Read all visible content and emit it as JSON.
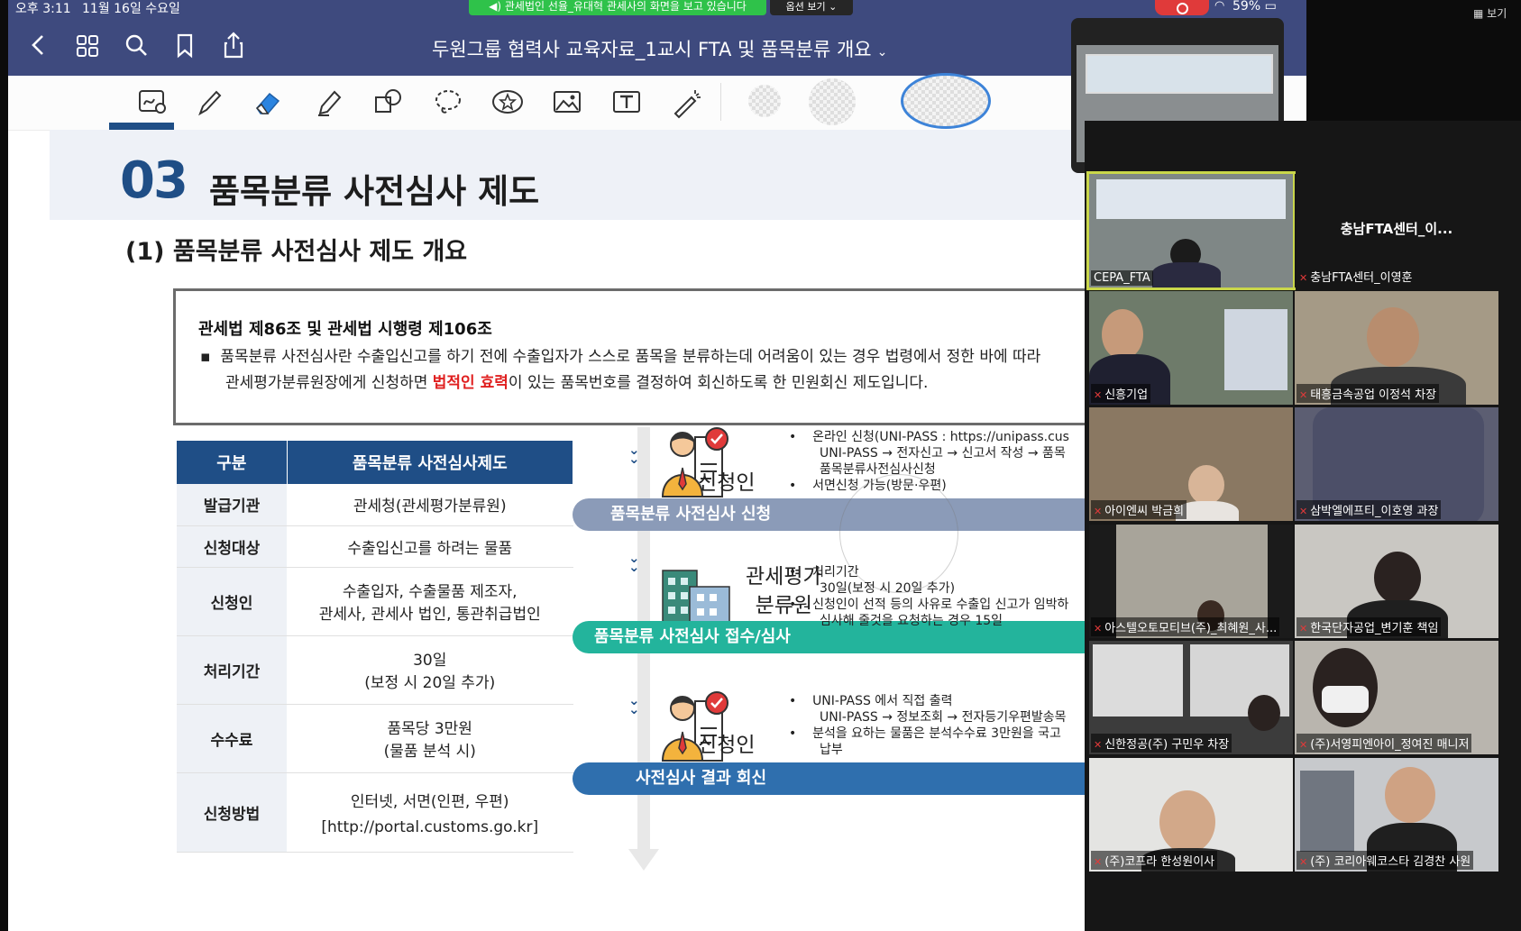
{
  "status_bar": {
    "time": "오후 3:11",
    "date": "11월 16일 수요일",
    "screen_share": "관세법인 선율_유대혁 관세사의 화면을 보고 있습니다",
    "options": "옵션 보기",
    "battery": "59%"
  },
  "view_toggle": "보기",
  "nav": {
    "title": "두원그룹 협력사 교육자료_1교시 FTA 및 품목분류 개요"
  },
  "slide": {
    "number": "03",
    "title": "품목분류 사전심사 제도",
    "subtitle": "(1) 품목분류 사전심사 제도 개요",
    "law_heading": "관세법 제86조 및 관세법 시행령 제106조",
    "law_line1": "품목분류 사전심사란 수출입신고를 하기 전에 수출입자가 스스로 품목을 분류하는데 어려움이 있는 경우 법령에서 정한 바에 따라",
    "law_line2_pre": "관세평가분류원장에게 신청하면 ",
    "law_line2_red": "법적인 효력",
    "law_line2_post": "이 있는 품목번호를 결정하여 회신하도록 한 민원회신 제도입니다."
  },
  "table": {
    "headers": [
      "구분",
      "품목분류 사전심사제도"
    ],
    "rows": [
      {
        "cat": "발급기관",
        "val1": "관세청(관세평가분류원)",
        "val2": ""
      },
      {
        "cat": "신청대상",
        "val1": "수출입신고를 하려는 물품",
        "val2": ""
      },
      {
        "cat": "신청인",
        "val1": "수출입자, 수출물품 제조자,",
        "val2": "관세사, 관세사 법인, 통관취급법인"
      },
      {
        "cat": "처리기간",
        "val1": "30일",
        "val2": "(보정 시 20일 추가)"
      },
      {
        "cat": "수수료",
        "val1": "품목당 3만원",
        "val2": "(물품 분석 시)"
      },
      {
        "cat": "신청방법",
        "val1": "인터넷, 서면(인편, 우편)",
        "val2": "[http://portal.customs.go.kr]"
      }
    ]
  },
  "flow": {
    "step1": {
      "actor": "신청인",
      "bar": "품목분류 사전심사 신청",
      "notes": [
        "온라인 신청(UNI-PASS : https://unipass.cus",
        "UNI-PASS → 전자신고 → 신고서 작성 → 품목",
        "품목분류사전심사신청",
        "서면신청 가능(방문·우편)"
      ]
    },
    "step2": {
      "actor_line1": "관세평가",
      "actor_line2": "분류원",
      "bar": "품목분류 사전심사 접수/심사",
      "notes": [
        "처리기간",
        "30일(보정 시 20일 추가)",
        "신청인이 선적 등의 사유로 수출입 신고가 임박하",
        "심사해 줄것을 요청하는 경우 15일"
      ]
    },
    "step3": {
      "actor": "신청인",
      "bar": "사전심사 결과 회신",
      "notes": [
        "UNI-PASS 에서 직접 출력",
        "UNI-PASS → 정보조회 → 전자등기우편발송목",
        "분석을 요하는 물품은 분석수수료 3만원을 국고",
        "납부"
      ]
    }
  },
  "participants": [
    {
      "name": "CEPA_FTA"
    },
    {
      "name": "충남FTA센터_이영훈",
      "display": "충남FTA센터_이..."
    },
    {
      "name": "신흥기업"
    },
    {
      "name": "태흥금속공업 이정석 차장"
    },
    {
      "name": "아이엔씨 박금희"
    },
    {
      "name": "삼박엘에프티_이호영 과장"
    },
    {
      "name": "아스텔오토모티브(주)_최혜원_사..."
    },
    {
      "name": "한국단자공업_변기훈 책임"
    },
    {
      "name": "신한정공(주) 구민우 차장"
    },
    {
      "name": "(주)서영피엔아이_정여진 매니저"
    },
    {
      "name": "(주)코프라 한성원이사"
    },
    {
      "name": "(주) 코리아웨코스타 김경찬 사원"
    }
  ],
  "colors": {
    "nav_bg": "#3e4a7e",
    "slide_blue": "#1f4e86",
    "bar1": "#8b9bb8",
    "bar2": "#23b49c",
    "bar3": "#2f6fae",
    "share_green": "#2fc24a",
    "active_speaker": "#c9d64a"
  }
}
